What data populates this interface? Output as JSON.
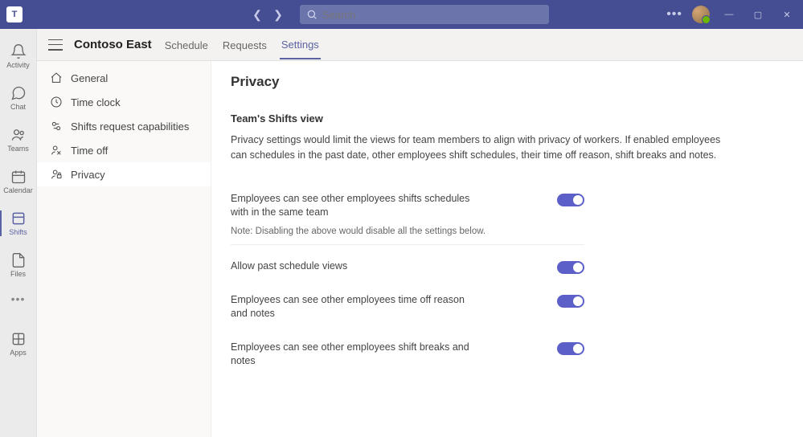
{
  "search": {
    "placeholder": "Search"
  },
  "rail": {
    "items": [
      {
        "label": "Activity"
      },
      {
        "label": "Chat"
      },
      {
        "label": "Teams"
      },
      {
        "label": "Calendar"
      },
      {
        "label": "Shifts"
      },
      {
        "label": "Files"
      }
    ],
    "apps": {
      "label": "Apps"
    }
  },
  "header": {
    "team_name": "Contoso East",
    "tabs": [
      {
        "label": "Schedule"
      },
      {
        "label": "Requests"
      },
      {
        "label": "Settings"
      }
    ]
  },
  "settings_nav": [
    {
      "label": "General"
    },
    {
      "label": "Time clock"
    },
    {
      "label": "Shifts request capabilities"
    },
    {
      "label": "Time off"
    },
    {
      "label": "Privacy"
    }
  ],
  "content": {
    "title": "Privacy",
    "section_title": "Team's Shifts view",
    "section_desc": "Privacy settings would limit the views for team members to align with privacy of workers. If enabled employees can schedules in the past date, other employees shift schedules, their time off reason, shift breaks and notes.",
    "settings": [
      {
        "label": "Employees can see other employees shifts schedules with in the same team",
        "on": true
      },
      {
        "label": "Allow past schedule views",
        "on": true
      },
      {
        "label": "Employees can see other employees time off reason and notes",
        "on": true
      },
      {
        "label": "Employees can see other employees shift breaks and notes",
        "on": true
      }
    ],
    "note": "Note: Disabling the above would disable all the settings below."
  }
}
